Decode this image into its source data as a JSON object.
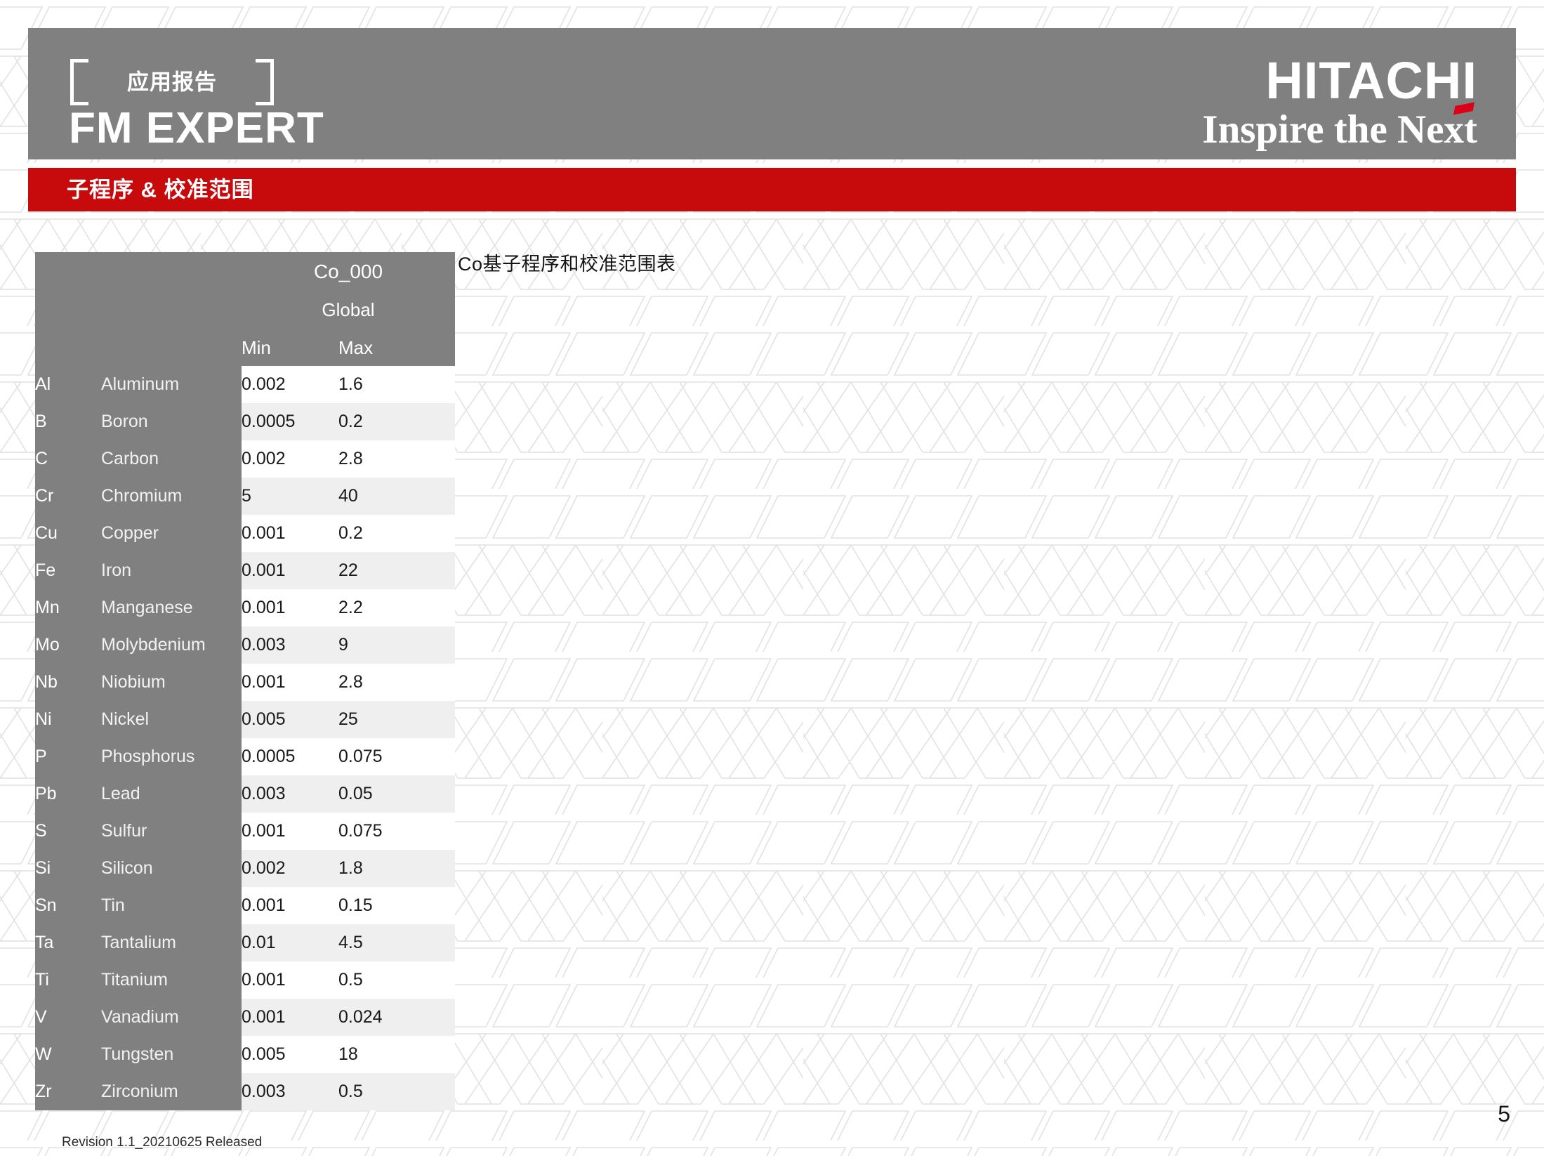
{
  "header": {
    "kicker": "应用报告",
    "product_title": "FM EXPERT",
    "logo_wordmark": "HITACHI",
    "logo_tagline": "Inspire the Next"
  },
  "section": {
    "title": "子程序 & 校准范围"
  },
  "caption": "Co基子程序和校准范围表",
  "table": {
    "group_label": "Co_000",
    "subgroup_label": "Global",
    "columns": {
      "min": "Min",
      "max": "Max"
    },
    "rows": [
      {
        "symbol": "Al",
        "name": "Aluminum",
        "min": "0.002",
        "max": "1.6"
      },
      {
        "symbol": "B",
        "name": "Boron",
        "min": "0.0005",
        "max": "0.2"
      },
      {
        "symbol": "C",
        "name": "Carbon",
        "min": "0.002",
        "max": "2.8"
      },
      {
        "symbol": "Cr",
        "name": "Chromium",
        "min": "5",
        "max": "40"
      },
      {
        "symbol": "Cu",
        "name": "Copper",
        "min": "0.001",
        "max": "0.2"
      },
      {
        "symbol": "Fe",
        "name": "Iron",
        "min": "0.001",
        "max": "22"
      },
      {
        "symbol": "Mn",
        "name": "Manganese",
        "min": "0.001",
        "max": "2.2"
      },
      {
        "symbol": "Mo",
        "name": "Molybdenium",
        "min": "0.003",
        "max": "9"
      },
      {
        "symbol": "Nb",
        "name": "Niobium",
        "min": "0.001",
        "max": "2.8"
      },
      {
        "symbol": "Ni",
        "name": "Nickel",
        "min": "0.005",
        "max": "25"
      },
      {
        "symbol": "P",
        "name": "Phosphorus",
        "min": "0.0005",
        "max": "0.075"
      },
      {
        "symbol": "Pb",
        "name": "Lead",
        "min": "0.003",
        "max": "0.05"
      },
      {
        "symbol": "S",
        "name": "Sulfur",
        "min": "0.001",
        "max": "0.075"
      },
      {
        "symbol": "Si",
        "name": "Silicon",
        "min": "0.002",
        "max": "1.8"
      },
      {
        "symbol": "Sn",
        "name": "Tin",
        "min": "0.001",
        "max": "0.15"
      },
      {
        "symbol": "Ta",
        "name": "Tantalium",
        "min": "0.01",
        "max": "4.5"
      },
      {
        "symbol": "Ti",
        "name": "Titanium",
        "min": "0.001",
        "max": "0.5"
      },
      {
        "symbol": "V",
        "name": "Vanadium",
        "min": "0.001",
        "max": "0.024"
      },
      {
        "symbol": "W",
        "name": "Tungsten",
        "min": "0.005",
        "max": "18"
      },
      {
        "symbol": "Zr",
        "name": "Zirconium",
        "min": "0.003",
        "max": "0.5"
      }
    ]
  },
  "footer": {
    "revision": "Revision 1.1_20210625 Released",
    "page_number": "5"
  },
  "colors": {
    "header_gray": "#808080",
    "banner_red": "#c70a0c",
    "stripe": "#efefef",
    "logo_accent_red": "#dd0019"
  }
}
